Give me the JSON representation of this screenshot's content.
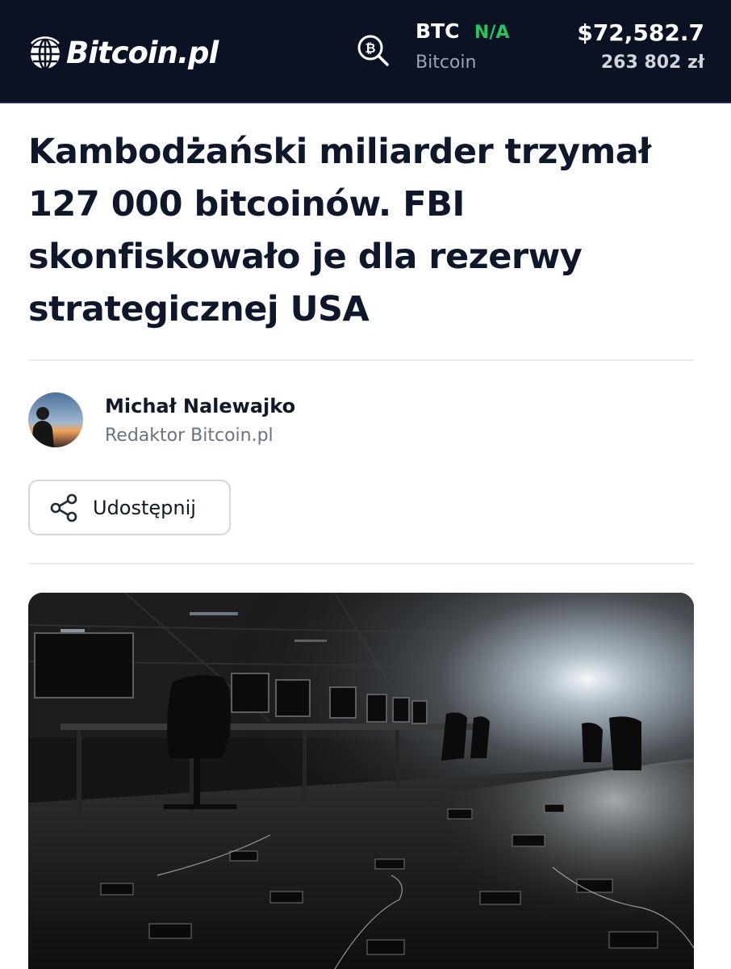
{
  "header": {
    "logo_text": "Bitcoin.pl",
    "ticker": {
      "symbol": "BTC",
      "change": "N/A",
      "name": "Bitcoin"
    },
    "price": {
      "usd": "$72,582.7",
      "pln": "263 802 zł"
    }
  },
  "article": {
    "headline": "Kambodżański miliarder trzymał 127 000 bitcoinów. FBI skonfiskowało je dla rezerwy strategicznej USA",
    "author": {
      "name": "Michał Nalewajko",
      "role": "Redaktor Bitcoin.pl"
    },
    "share_label": "Udostępnij"
  },
  "colors": {
    "header_bg": "#0b1224",
    "change_green": "#22c55e",
    "headline": "#0f172a"
  },
  "icons": [
    "globe-logo-icon",
    "bitcoin-search-icon",
    "share-icon"
  ]
}
